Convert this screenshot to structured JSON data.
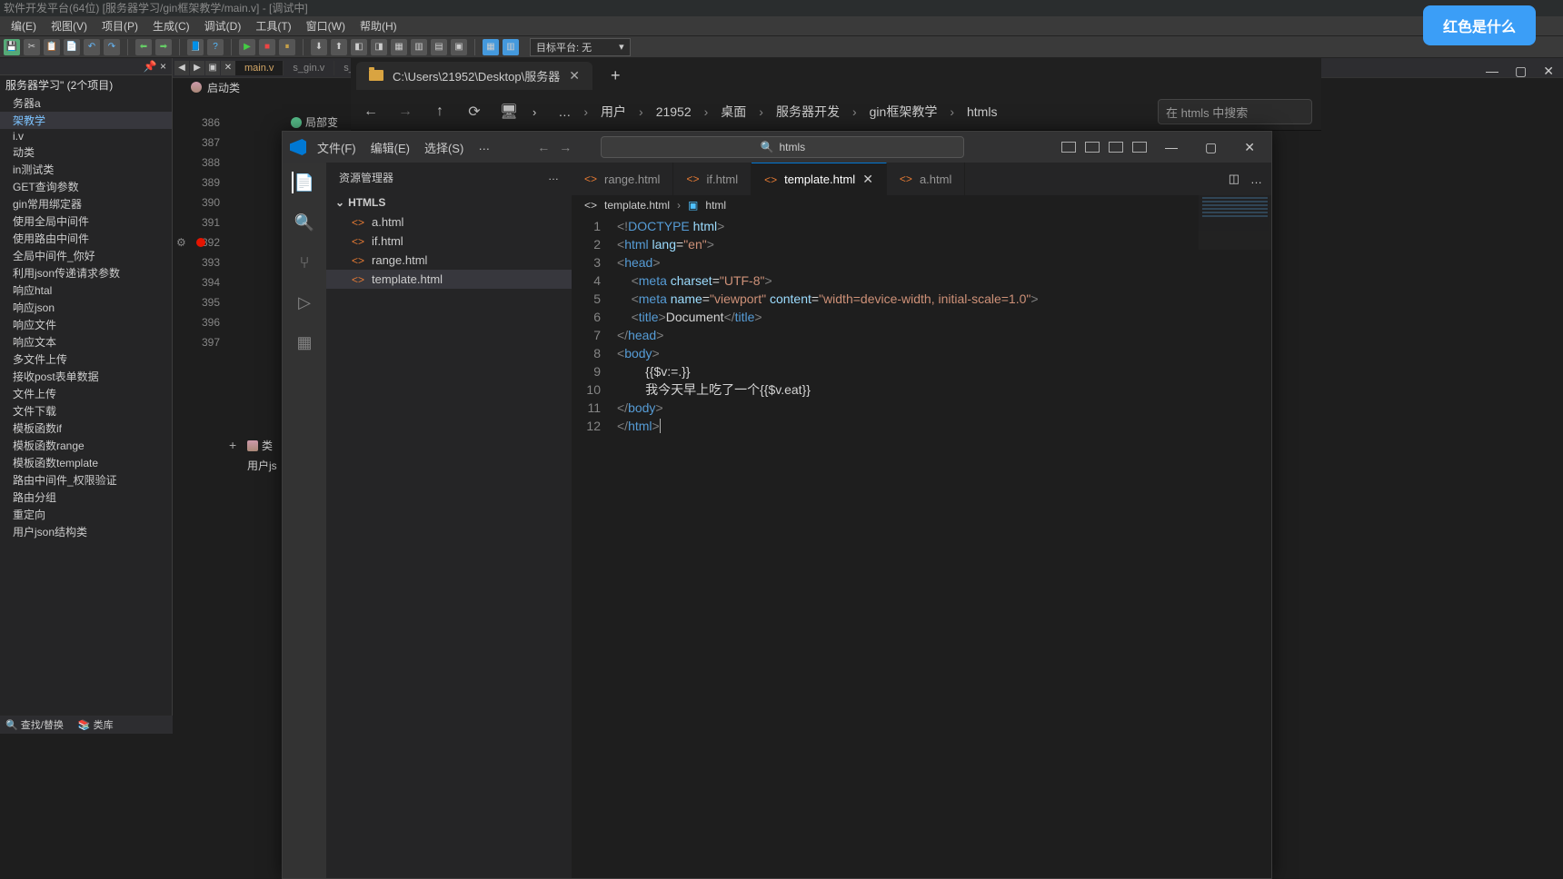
{
  "ide": {
    "title": "软件开发平台(64位) [服务器学习/gin框架教学/main.v] - [调试中]",
    "menu": [
      "编(E)",
      "视图(V)",
      "项目(P)",
      "生成(C)",
      "调试(D)",
      "工具(T)",
      "窗口(W)",
      "帮助(H)"
    ],
    "target_label": "目标平台: 无"
  },
  "blue_pill": "红色是什么",
  "left_tree": {
    "header_pin": "📌 ×",
    "root": "服务器学习\" (2个项目)",
    "items": [
      {
        "t": "务器a",
        "sel": false
      },
      {
        "t": "架教学",
        "sel": true,
        "hl": true
      },
      {
        "t": "i.v",
        "sel": false
      },
      {
        "t": "动类",
        "sel": false
      },
      {
        "t": "in测试类",
        "sel": false
      },
      {
        "t": "GET查询参数",
        "sel": false
      },
      {
        "t": "gin常用绑定器",
        "sel": false
      },
      {
        "t": "使用全局中间件",
        "sel": false
      },
      {
        "t": "使用路由中间件",
        "sel": false
      },
      {
        "t": "全局中间件_你好",
        "sel": false
      },
      {
        "t": "利用json传递请求参数",
        "sel": false
      },
      {
        "t": "响应htal",
        "sel": false
      },
      {
        "t": "响应json",
        "sel": false
      },
      {
        "t": "响应文件",
        "sel": false
      },
      {
        "t": "响应文本",
        "sel": false
      },
      {
        "t": "多文件上传",
        "sel": false
      },
      {
        "t": "接收post表单数据",
        "sel": false
      },
      {
        "t": "文件上传",
        "sel": false
      },
      {
        "t": "文件下载",
        "sel": false
      },
      {
        "t": "模板函数if",
        "sel": false
      },
      {
        "t": "模板函数range",
        "sel": false
      },
      {
        "t": "模板函数template",
        "sel": false
      },
      {
        "t": "路由中间件_权限验证",
        "sel": false
      },
      {
        "t": "路由分组",
        "sel": false
      },
      {
        "t": "重定向",
        "sel": false
      },
      {
        "t": "用户json结构类",
        "sel": false
      }
    ]
  },
  "bg_editor": {
    "tabs": [
      "main.v",
      "s_gin.v",
      "s_b"
    ],
    "sub_label": "启动类",
    "side_label": "局部变",
    "gutter": [
      "386",
      "387",
      "388",
      "",
      "389",
      "390",
      "391",
      "392",
      "393",
      "394",
      "395",
      "",
      "396",
      "",
      "",
      "",
      "397"
    ],
    "bp_row_idx": 7,
    "class_label": "类",
    "user_label": "用户js"
  },
  "bottom_bar": {
    "find": "查找/替换",
    "lib": "类库"
  },
  "file_explorer": {
    "tab_path": "C:\\Users\\21952\\Desktop\\服务器",
    "crumbs": [
      "…",
      "用户",
      "21952",
      "桌面",
      "服务器开发",
      "gin框架教学",
      "htmls"
    ],
    "search_placeholder": "在 htmls 中搜索"
  },
  "vscode": {
    "menu": [
      "文件(F)",
      "编辑(E)",
      "选择(S)"
    ],
    "search_text": "htmls",
    "sidebar_title": "资源管理器",
    "folder": "HTMLS",
    "files": [
      "a.html",
      "if.html",
      "range.html",
      "template.html"
    ],
    "selected_file": "template.html",
    "tabs": [
      "range.html",
      "if.html",
      "template.html",
      "a.html"
    ],
    "active_tab": "template.html",
    "breadcrumb": {
      "a": "template.html",
      "b": "html"
    },
    "code_lines": [
      "1",
      "2",
      "3",
      "4",
      "5",
      "6",
      "7",
      "8",
      "9",
      "10",
      "11",
      "12"
    ],
    "code": {
      "l9": "        {{$v:=.}}",
      "l10": "        我今天早上吃了一个{{$v.eat}}"
    }
  }
}
